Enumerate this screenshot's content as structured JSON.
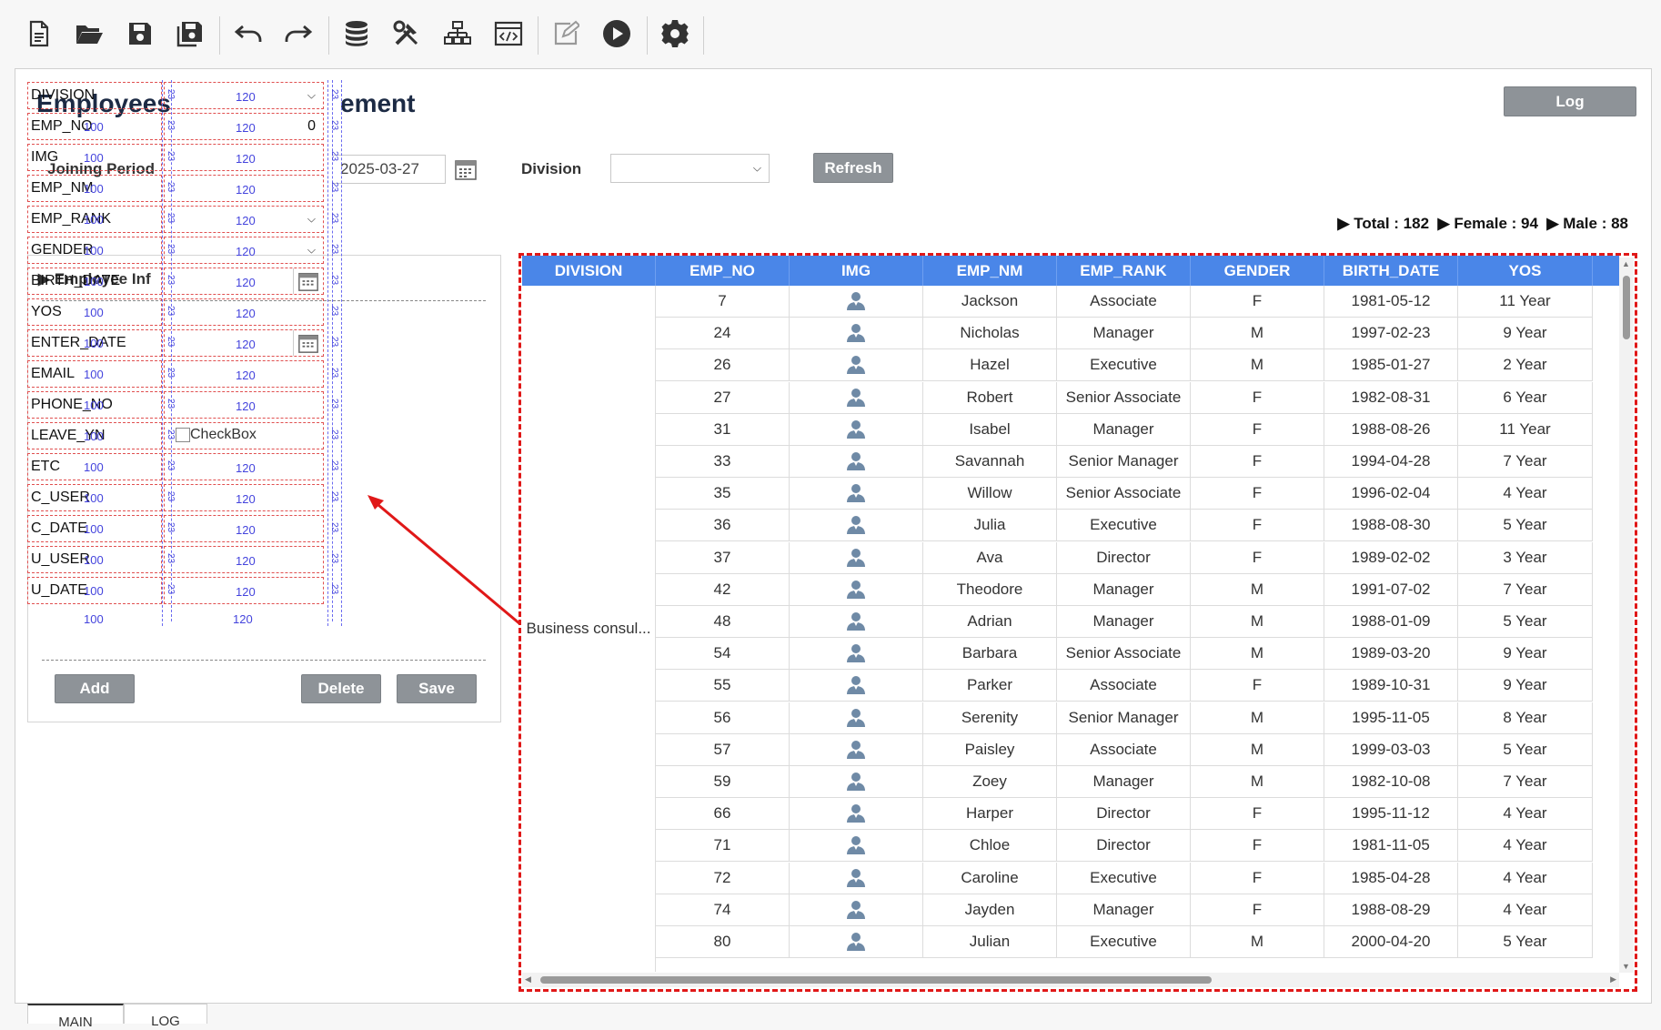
{
  "toolbar": {
    "icons": [
      "new-file-icon",
      "open-folder-icon",
      "save-icon",
      "save-all-icon",
      "undo-icon",
      "redo-icon",
      "database-icon",
      "tools-icon",
      "hierarchy-icon",
      "code-view-icon",
      "edit-icon",
      "run-icon",
      "settings-icon"
    ]
  },
  "page": {
    "title_left": "Employees",
    "title_right": "ement",
    "log_label": "Log"
  },
  "search": {
    "joining_period_label": "Joining Period",
    "date_to": "2025-03-27",
    "division_label": "Division",
    "division_value": "",
    "refresh_label": "Refresh"
  },
  "summary": {
    "total_label": "Total : 182",
    "female_label": "Female : 94",
    "male_label": "Male : 88"
  },
  "panel": {
    "title": "Employee Inf",
    "add_label": "Add",
    "delete_label": "Delete",
    "save_label": "Save"
  },
  "form": {
    "fields": [
      {
        "label": "DIVISION",
        "type": "select"
      },
      {
        "label": "EMP_NO",
        "type": "number",
        "value": "0"
      },
      {
        "label": "IMG",
        "type": "text"
      },
      {
        "label": "EMP_NM",
        "type": "text"
      },
      {
        "label": "EMP_RANK",
        "type": "select"
      },
      {
        "label": "GENDER",
        "type": "select"
      },
      {
        "label": "BIRTH_DATE",
        "type": "date"
      },
      {
        "label": "YOS",
        "type": "text"
      },
      {
        "label": "ENTER_DATE",
        "type": "date"
      },
      {
        "label": "EMAIL",
        "type": "text"
      },
      {
        "label": "PHONE_NO",
        "type": "text"
      },
      {
        "label": "LEAVE_YN",
        "type": "checkbox",
        "value": "CheckBox"
      },
      {
        "label": "ETC",
        "type": "text"
      },
      {
        "label": "C_USER",
        "type": "text"
      },
      {
        "label": "C_DATE",
        "type": "text"
      },
      {
        "label": "U_USER",
        "type": "text"
      },
      {
        "label": "U_DATE",
        "type": "text"
      }
    ],
    "col_width_left": "100",
    "col_width_right": "120",
    "row_height_mark": "23"
  },
  "grid": {
    "columns": [
      "DIVISION",
      "EMP_NO",
      "IMG",
      "EMP_NM",
      "EMP_RANK",
      "GENDER",
      "BIRTH_DATE",
      "YOS"
    ],
    "division_merged": "Business consul...",
    "rows": [
      [
        "7",
        "Jackson",
        "Associate",
        "F",
        "1981-05-12",
        "11 Year"
      ],
      [
        "24",
        "Nicholas",
        "Manager",
        "M",
        "1997-02-23",
        "9 Year"
      ],
      [
        "26",
        "Hazel",
        "Executive",
        "M",
        "1985-01-27",
        "2 Year"
      ],
      [
        "27",
        "Robert",
        "Senior Associate",
        "F",
        "1982-08-31",
        "6 Year"
      ],
      [
        "31",
        "Isabel",
        "Manager",
        "F",
        "1988-08-26",
        "11 Year"
      ],
      [
        "33",
        "Savannah",
        "Senior Manager",
        "F",
        "1994-04-28",
        "7 Year"
      ],
      [
        "35",
        "Willow",
        "Senior Associate",
        "F",
        "1996-02-04",
        "4 Year"
      ],
      [
        "36",
        "Julia",
        "Executive",
        "F",
        "1988-08-30",
        "5 Year"
      ],
      [
        "37",
        "Ava",
        "Director",
        "F",
        "1989-02-02",
        "3 Year"
      ],
      [
        "42",
        "Theodore",
        "Manager",
        "M",
        "1991-07-02",
        "7 Year"
      ],
      [
        "48",
        "Adrian",
        "Manager",
        "M",
        "1988-01-09",
        "5 Year"
      ],
      [
        "54",
        "Barbara",
        "Senior Associate",
        "M",
        "1989-03-20",
        "9 Year"
      ],
      [
        "55",
        "Parker",
        "Associate",
        "F",
        "1989-10-31",
        "9 Year"
      ],
      [
        "56",
        "Serenity",
        "Senior Manager",
        "M",
        "1995-11-05",
        "8 Year"
      ],
      [
        "57",
        "Paisley",
        "Associate",
        "M",
        "1999-03-03",
        "5 Year"
      ],
      [
        "59",
        "Zoey",
        "Manager",
        "M",
        "1982-10-08",
        "7 Year"
      ],
      [
        "66",
        "Harper",
        "Director",
        "F",
        "1995-11-12",
        "4 Year"
      ],
      [
        "71",
        "Chloe",
        "Director",
        "F",
        "1981-11-05",
        "4 Year"
      ],
      [
        "72",
        "Caroline",
        "Executive",
        "F",
        "1985-04-28",
        "4 Year"
      ],
      [
        "74",
        "Jayden",
        "Manager",
        "F",
        "1988-08-29",
        "4 Year"
      ],
      [
        "80",
        "Julian",
        "Executive",
        "M",
        "2000-04-20",
        "5 Year"
      ]
    ]
  },
  "tabs": [
    "MAIN",
    "LOG"
  ],
  "colors": {
    "grid_header": "#4a86e8",
    "button_gray": "#8e9398",
    "annotation_red": "#e01818"
  }
}
